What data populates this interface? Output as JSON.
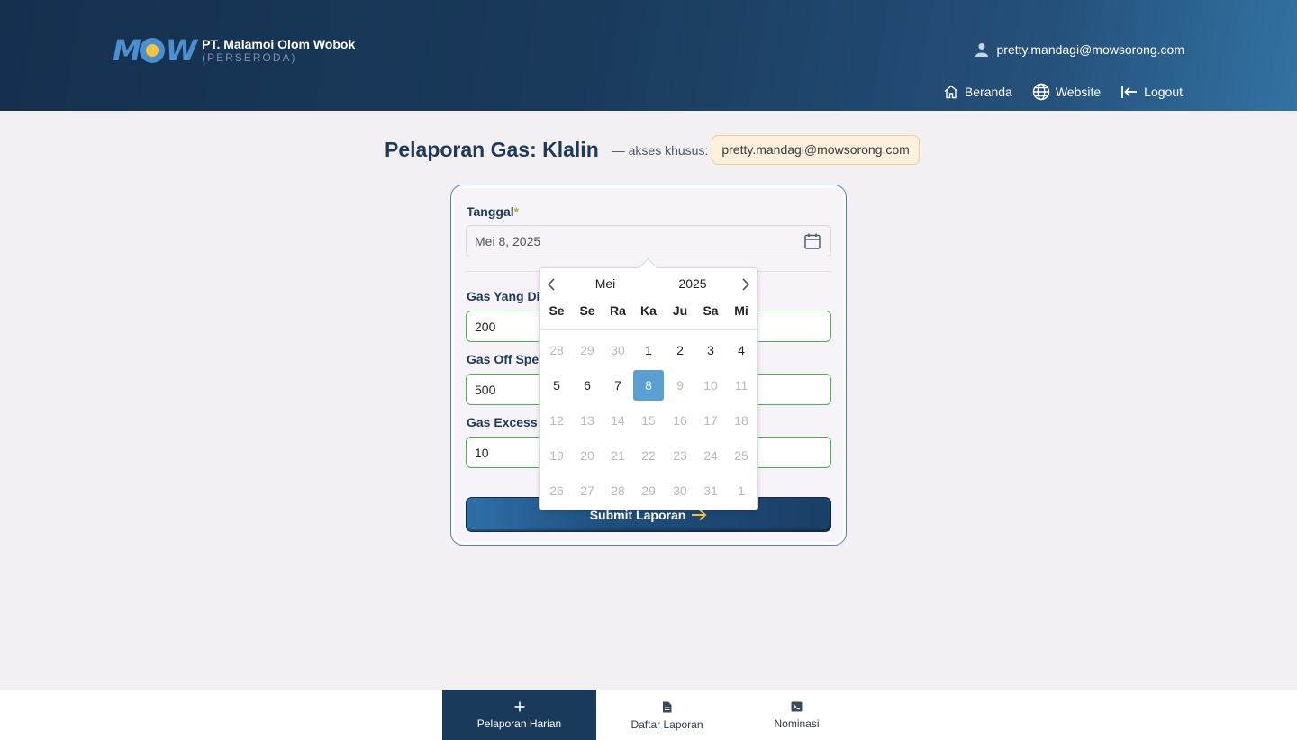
{
  "header": {
    "logo_text": "MOW",
    "company_name": "PT. Malamoi Olom Wobok",
    "company_sub": "(PERSERODA)",
    "user_email": "pretty.mandagi@mowsorong.com",
    "nav": [
      {
        "label": "Beranda",
        "icon": "home-icon"
      },
      {
        "label": "Website",
        "icon": "globe-icon"
      },
      {
        "label": "Logout",
        "icon": "logout-icon"
      }
    ]
  },
  "page": {
    "title": "Pelaporan Gas: Klalin",
    "access_label": "— akses khusus:",
    "access_email": "pretty.mandagi@mowsorong.com"
  },
  "form": {
    "date_label": "Tanggal",
    "required_mark": "*",
    "date_value": "Mei 8, 2025",
    "fields": [
      {
        "label": "Gas Yang Dia",
        "value": "200"
      },
      {
        "label": "Gas Off Spec",
        "value": "500"
      },
      {
        "label": "Gas Excess (",
        "value": "10"
      }
    ],
    "submit_label": "Submit Laporan"
  },
  "datepicker": {
    "month": "Mei",
    "year": "2025",
    "weekdays": [
      "Se",
      "Se",
      "Ra",
      "Ka",
      "Ju",
      "Sa",
      "Mi"
    ],
    "weeks": [
      [
        "28",
        "29",
        "30",
        "1",
        "2",
        "3",
        "4"
      ],
      [
        "5",
        "6",
        "7",
        "8",
        "9",
        "10",
        "11"
      ],
      [
        "12",
        "13",
        "14",
        "15",
        "16",
        "17",
        "18"
      ],
      [
        "19",
        "20",
        "21",
        "22",
        "23",
        "24",
        "25"
      ],
      [
        "26",
        "27",
        "28",
        "29",
        "30",
        "31",
        "1"
      ]
    ],
    "selected": "8"
  },
  "bottom_nav": [
    {
      "label": "Pelaporan Harian",
      "icon": "plus-icon",
      "active": true
    },
    {
      "label": "Daftar Laporan",
      "icon": "document-icon",
      "active": false
    },
    {
      "label": "Nominasi",
      "icon": "terminal-icon",
      "active": false
    }
  ],
  "colors": {
    "header_dark": "#14304d",
    "accent_blue": "#4a7fd0",
    "success_green": "#4caf50",
    "selected_day": "#5a9fd4",
    "required": "#d9a441"
  }
}
